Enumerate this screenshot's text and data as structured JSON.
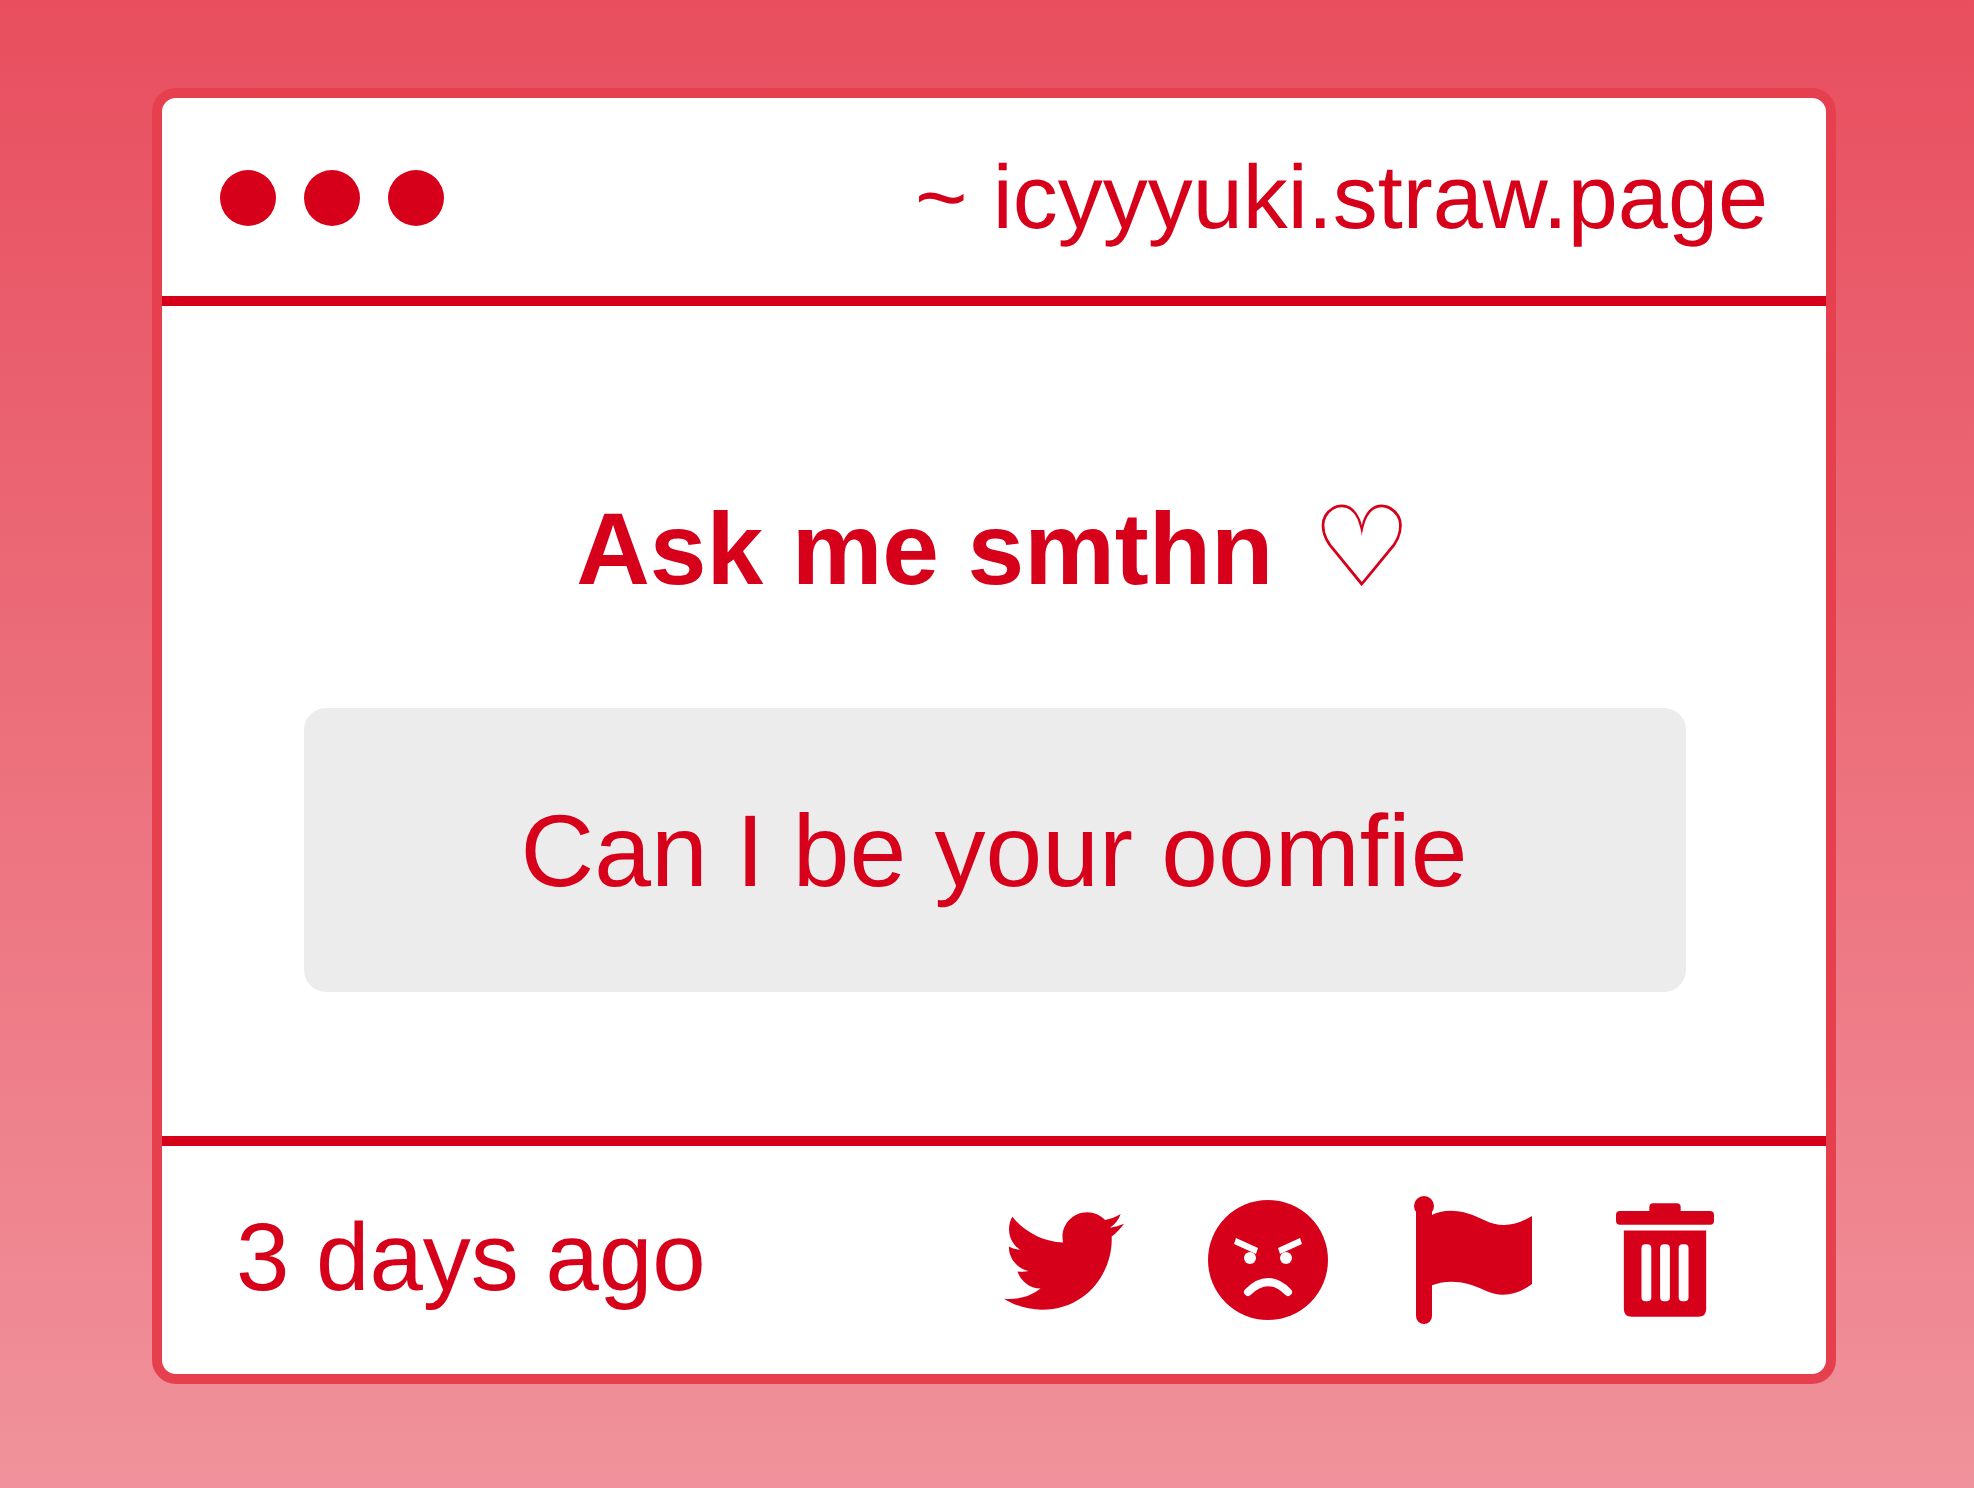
{
  "header": {
    "url": "~ icyyyuki.straw.page"
  },
  "prompt": {
    "title": "Ask me smthn",
    "symbol": "♡"
  },
  "question": {
    "text": "Can I be your oomfie"
  },
  "footer": {
    "time": "3 days ago",
    "actions": [
      {
        "kind": "twitter"
      },
      {
        "kind": "react"
      },
      {
        "kind": "report"
      },
      {
        "kind": "delete"
      }
    ]
  }
}
